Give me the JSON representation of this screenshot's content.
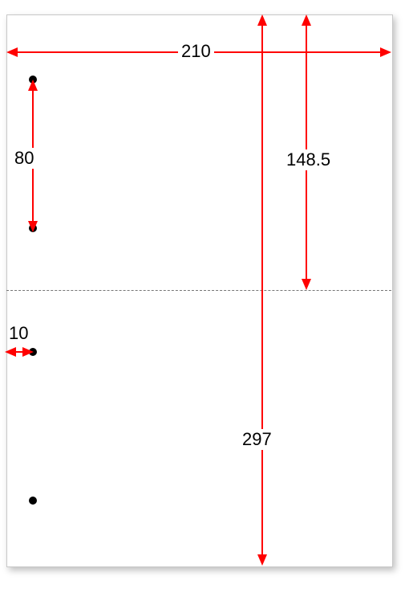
{
  "page": {
    "width_mm": 210,
    "height_mm": 297,
    "half_height_mm": 148.5,
    "hole_spacing_mm": 80,
    "hole_margin_mm": 10
  },
  "labels": {
    "width": "210",
    "height": "297",
    "half": "148.5",
    "hole_spacing": "80",
    "hole_margin": "10"
  },
  "colors": {
    "arrow": "#ff0000",
    "hole": "#000000",
    "perforation": "#777777",
    "paper_border": "#c8c8c8"
  }
}
